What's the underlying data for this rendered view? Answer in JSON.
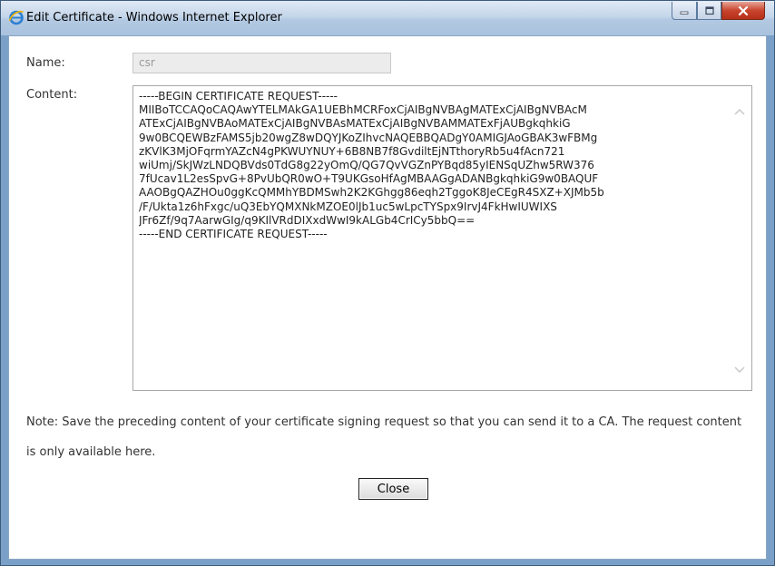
{
  "window": {
    "title": "Edit Certificate - Windows Internet Explorer",
    "controls": {
      "minimize_icon": "minimize-icon",
      "maximize_icon": "maximize-icon",
      "close_icon": "close-icon"
    },
    "accent_color": "#c8452e"
  },
  "form": {
    "name_label": "Name:",
    "name_value": "csr",
    "content_label": "Content:",
    "content_lines": [
      "-----BEGIN CERTIFICATE REQUEST-----",
      "MIIBoTCCAQoCAQAwYTELMAkGA1UEBhMCRFoxCjAIBgNVBAgMATExCjAIBgNVBAcM",
      "ATExCjAIBgNVBAoMATExCjAIBgNVBAsMATExCjAIBgNVBAMMATExFjAUBgkqhkiG",
      "9w0BCQEWBzFAMS5jb20wgZ8wDQYJKoZIhvcNAQEBBQADgY0AMIGJAoGBAK3wFBMg",
      "zKVlK3MjOFqrmYAZcN4gPKWUYNUY+6B8NB7f8GvdiltEjNTthoryRb5u4fAcn721",
      "wiUmj/SkJWzLNDQBVds0TdG8g22yOmQ/QG7QvVGZnPYBqd85yIENSqUZhw5RW376",
      "7fUcav1L2esSpvG+8PvUbQR0wO+T9UKGsoHfAgMBAAGgADANBgkqhkiG9w0BAQUF",
      "AAOBgQAZHOu0ggKcQMMhYBDMSwh2K2KGhgg86eqh2TggoK8JeCEgR4SXZ+XJMb5b",
      "/F/Ukta1z6hFxgc/uQ3EbYQMXNkMZOE0lJb1uc5wLpcTYSpx9IrvJ4FkHwIUWIXS",
      "JFr6Zf/9q7AarwGIg/q9KIlVRdDIXxdWwI9kALGb4CrICy5bbQ==",
      "-----END CERTIFICATE REQUEST-----"
    ]
  },
  "note": {
    "text": "Note: Save the preceding content of your certificate signing request so that you can send it to a CA. The request content is only available here."
  },
  "buttons": {
    "close_label": "Close"
  }
}
